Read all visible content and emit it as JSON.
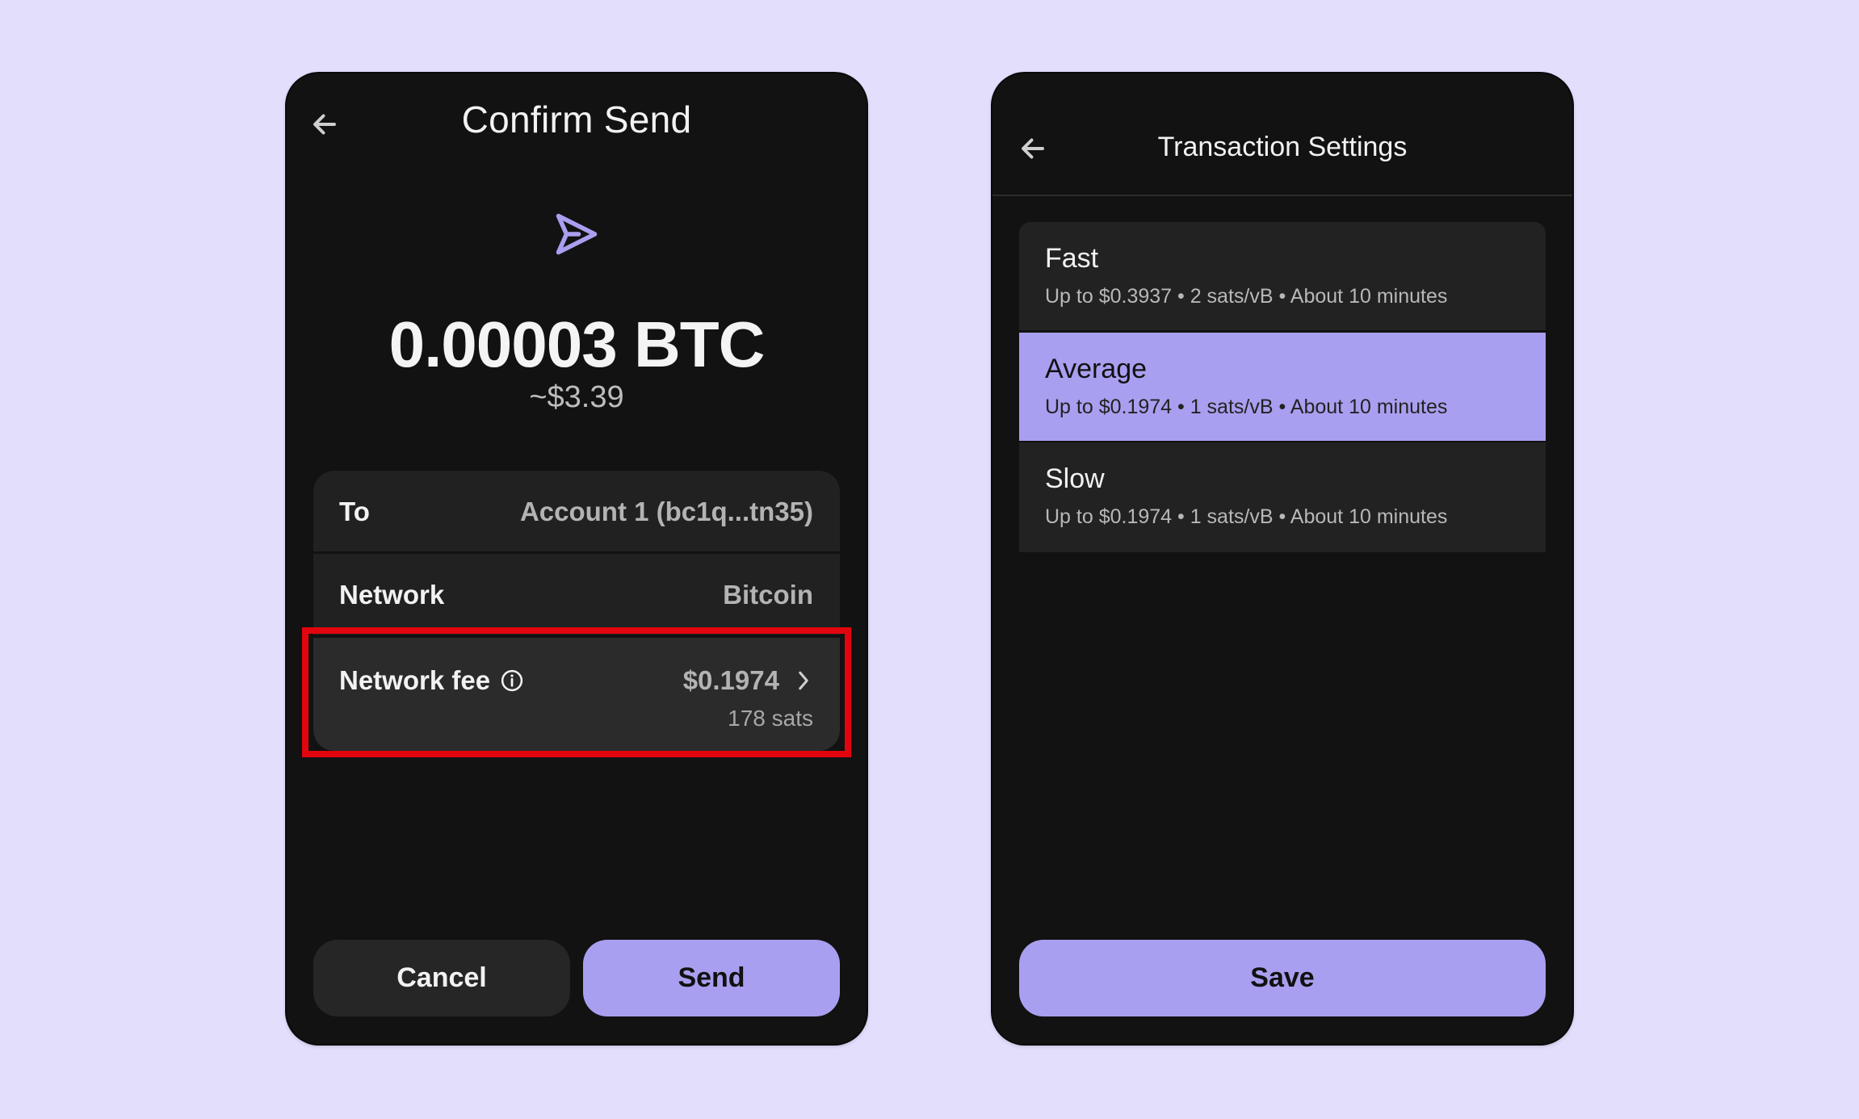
{
  "confirm_send": {
    "title": "Confirm Send",
    "amount": "0.00003 BTC",
    "fiat_amount": "~$3.39",
    "rows": {
      "to": {
        "label": "To",
        "value": "Account 1 (bc1q...tn35)"
      },
      "network": {
        "label": "Network",
        "value": "Bitcoin"
      },
      "network_fee": {
        "label": "Network fee",
        "value": "$0.1974",
        "sub_value": "178 sats"
      }
    },
    "buttons": {
      "cancel": "Cancel",
      "send": "Send"
    },
    "icons": {
      "back": "arrow-left-icon",
      "send": "send-arrow-icon",
      "info": "info-icon",
      "chevron": "chevron-right-icon"
    }
  },
  "transaction_settings": {
    "title": "Transaction Settings",
    "options": [
      {
        "name": "Fast",
        "description": "Up to $0.3937 • 2 sats/vB • About 10 minutes",
        "selected": false
      },
      {
        "name": "Average",
        "description": "Up to $0.1974 • 1 sats/vB • About 10 minutes",
        "selected": true
      },
      {
        "name": "Slow",
        "description": "Up to $0.1974 • 1 sats/vB • About 10 minutes",
        "selected": false
      }
    ],
    "save_label": "Save"
  },
  "colors": {
    "background": "#e3defc",
    "panel": "#121212",
    "accent": "#a99ff0",
    "highlight": "#e3050d"
  }
}
